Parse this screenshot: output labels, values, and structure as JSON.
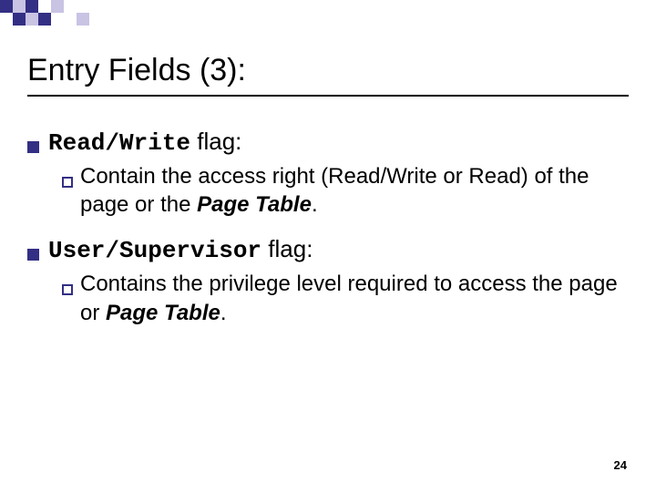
{
  "decor": {
    "accent": "#332f84",
    "light": "#c9c3e4"
  },
  "title": "Entry Fields (3):",
  "items": [
    {
      "code": "Read/Write",
      "suffix": " flag:",
      "sub_pre": "Contain the access right (Read/Write or Read) of the page or the ",
      "sub_em": "Page Table",
      "sub_post": "."
    },
    {
      "code": "User/Supervisor",
      "suffix": " flag:",
      "sub_pre": "Contains the privilege level required to access the page or ",
      "sub_em": "Page Table",
      "sub_post": "."
    }
  ],
  "page_number": "24"
}
